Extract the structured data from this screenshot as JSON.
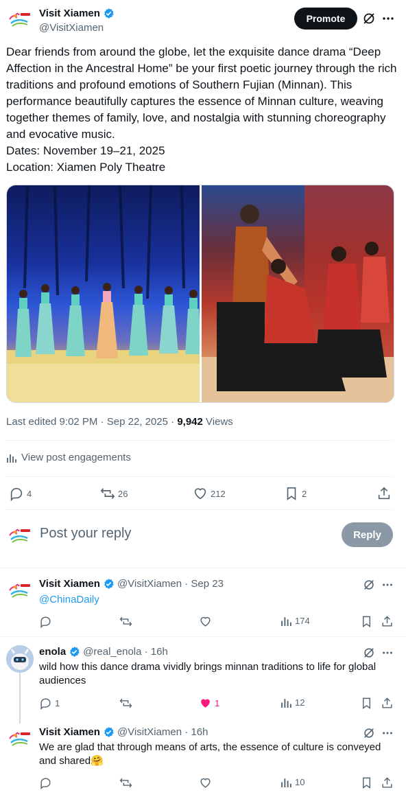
{
  "post": {
    "author_name": "Visit Xiamen",
    "author_handle": "@VisitXiamen",
    "promote_label": "Promote",
    "text": "Dear friends from around the globe, let the exquisite dance drama “Deep Affection in the Ancestral Home” be your first poetic journey through the rich traditions and profound emotions of Southern Fujian (Minnan). This performance beautifully captures the essence of Minnan culture, weaving together themes of family, love, and nostalgia with stunning choreography and evocative music.\nDates: November 19–21, 2025\nLocation: Xiamen Poly Theatre",
    "timestamp": "Last edited 9:02 PM · Sep 22, 2025 · ",
    "views_count": "9,942",
    "views_label": " Views",
    "engagements_label": "View post engagements",
    "replies": "4",
    "reposts": "26",
    "likes": "212",
    "bookmarks": "2"
  },
  "reply_box": {
    "placeholder": "Post your reply",
    "button_label": "Reply"
  },
  "comments": [
    {
      "name": "Visit Xiamen",
      "meta": "@VisitXiamen · Sep 23",
      "text": "@ChinaDaily",
      "replies": "",
      "likes": "",
      "views": "174"
    },
    {
      "name": "enola",
      "meta": "@real_enola · 16h",
      "text": "wild how this dance drama vividly brings minnan traditions to life for global audiences",
      "replies": "1",
      "likes": "1",
      "views": "12"
    },
    {
      "name": "Visit Xiamen",
      "meta": "@VisitXiamen · 16h",
      "text": "We are glad that through means of arts, the essence of culture is conveyed and shared🤗",
      "replies": "",
      "likes": "",
      "views": "10"
    }
  ],
  "colors": {
    "accent": "#1d9bf0",
    "like_active": "#f91880",
    "text": "#0f1419",
    "muted": "#536471"
  }
}
